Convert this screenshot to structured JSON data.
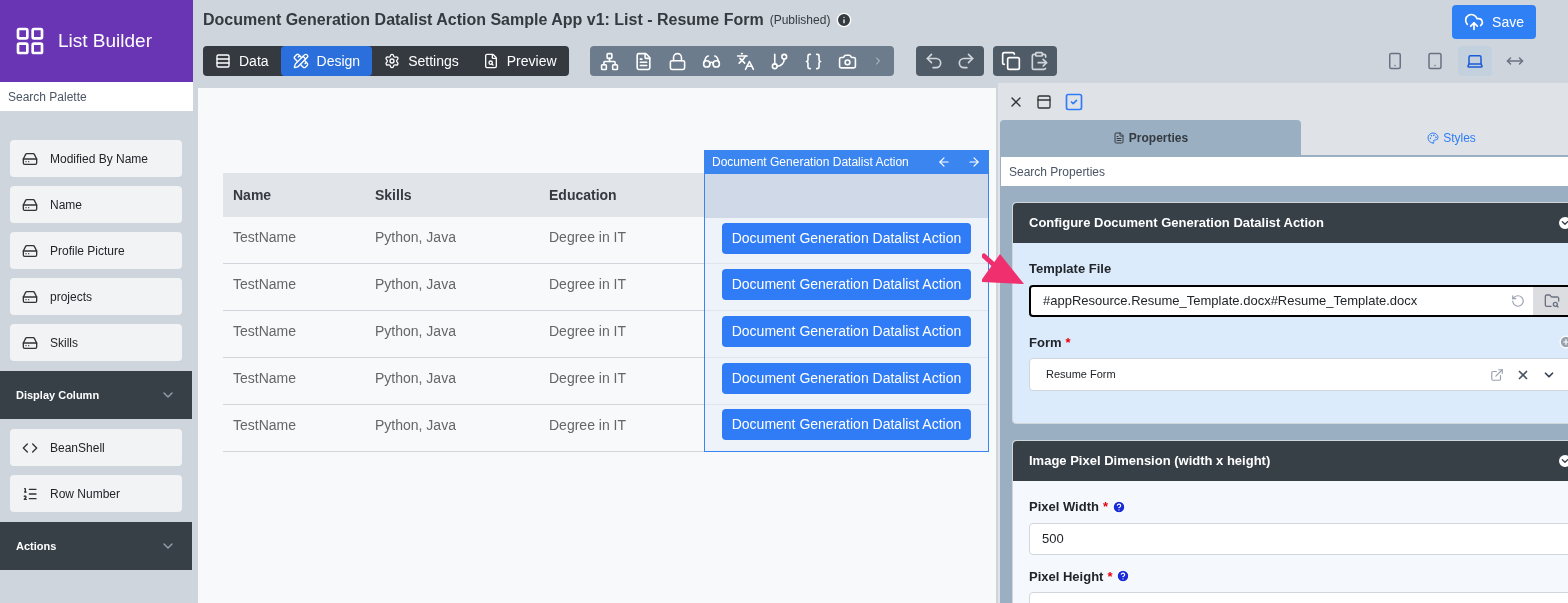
{
  "app_title": "List Builder",
  "header": {
    "title": "Document Generation Datalist Action Sample App v1: List - Resume Form",
    "status": "(Published)",
    "save_label": "Save"
  },
  "mode_tabs": [
    {
      "kind": "data",
      "label": "Data",
      "selected": false
    },
    {
      "kind": "design",
      "label": "Design",
      "selected": true
    },
    {
      "kind": "settings",
      "label": "Settings",
      "selected": false
    },
    {
      "kind": "preview",
      "label": "Preview",
      "selected": false
    }
  ],
  "device_modes": [
    {
      "kind": "phone",
      "selected": false
    },
    {
      "kind": "tablet",
      "selected": false
    },
    {
      "kind": "laptop",
      "selected": true
    },
    {
      "kind": "wide",
      "selected": false
    }
  ],
  "palette": {
    "search_placeholder": "Search Palette",
    "groups": [
      {
        "items": [
          {
            "label": "Modified By Name",
            "kind": "field"
          },
          {
            "label": "Name",
            "kind": "field"
          },
          {
            "label": "Profile Picture",
            "kind": "field"
          },
          {
            "label": "projects",
            "kind": "field"
          },
          {
            "label": "Skills",
            "kind": "field"
          }
        ]
      },
      {
        "title": "Display Column",
        "items": [
          {
            "label": "BeanShell",
            "kind": "code"
          },
          {
            "label": "Row Number",
            "kind": "numbered"
          }
        ]
      },
      {
        "title": "Actions"
      }
    ]
  },
  "table": {
    "columns": [
      "Name",
      "Skills",
      "Education"
    ],
    "action_column": {
      "label": "Document Generation Datalist Action",
      "selected": true
    },
    "rows": [
      {
        "cells": [
          "TestName",
          "Python, Java",
          "Degree in IT"
        ],
        "action": "Document Generation Datalist Action"
      },
      {
        "cells": [
          "TestName",
          "Python, Java",
          "Degree in IT"
        ],
        "action": "Document Generation Datalist Action"
      },
      {
        "cells": [
          "TestName",
          "Python, Java",
          "Degree in IT"
        ],
        "action": "Document Generation Datalist Action"
      },
      {
        "cells": [
          "TestName",
          "Python, Java",
          "Degree in IT"
        ],
        "action": "Document Generation Datalist Action"
      },
      {
        "cells": [
          "TestName",
          "Python, Java",
          "Degree in IT"
        ],
        "action": "Document Generation Datalist Action"
      }
    ]
  },
  "properties_panel": {
    "tabs": [
      {
        "kind": "properties",
        "label": "Properties",
        "selected": true
      },
      {
        "kind": "styles",
        "label": "Styles",
        "selected": false
      }
    ],
    "search_placeholder": "Search Properties",
    "sections": [
      {
        "title": "Configure Document Generation Datalist Action",
        "fields": [
          {
            "kind": "file",
            "label": "Template File",
            "value": "#appResource.Resume_Template.docx#Resume_Template.docx"
          },
          {
            "kind": "select",
            "label": "Form",
            "required_mark": "*",
            "value": "Resume Form"
          }
        ]
      },
      {
        "title": "Image Pixel Dimension (width x height)",
        "fields": [
          {
            "kind": "text",
            "label": "Pixel Width",
            "required_mark": "*",
            "help": true,
            "value": "500"
          },
          {
            "kind": "text",
            "label": "Pixel Height",
            "required_mark": "*",
            "help": true
          }
        ]
      }
    ]
  }
}
